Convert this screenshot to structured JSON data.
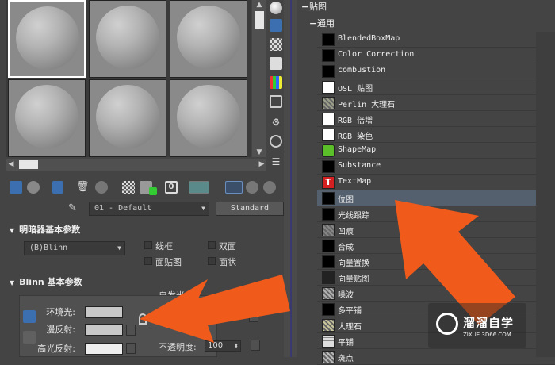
{
  "left": {
    "material_name": "01 - Default",
    "material_type_button": "Standard",
    "shader_rollout_title": "明暗器基本参数",
    "shader_value": "(B)Blinn",
    "shader_options": {
      "wire": "线框",
      "two_sided": "双面",
      "face_map": "面贴图",
      "faceted": "面状"
    },
    "blinn_rollout_title": "Blinn 基本参数",
    "self_illum_label": "自发光",
    "ambient_label": "环境光:",
    "diffuse_label": "漫反射:",
    "specular_label": "高光反射:",
    "opacity_label": "不透明度:",
    "opacity_value": "100"
  },
  "right": {
    "category_maps": "贴图",
    "category_general": "通用",
    "map_items": [
      {
        "label": "BlendedBoxMap",
        "icon": "black-swatch-icon",
        "color": "#000000"
      },
      {
        "label": "Color Correction",
        "icon": "black-swatch-icon",
        "color": "#000000"
      },
      {
        "label": "combustion",
        "icon": "black-swatch-icon",
        "color": "#000000"
      },
      {
        "label": "OSL 贴图",
        "icon": "white-swatch-icon",
        "color": "#ffffff"
      },
      {
        "label": "Perlin 大理石",
        "icon": "marble-swatch-icon",
        "color": "#9aa08a"
      },
      {
        "label": "RGB 倍增",
        "icon": "white-swatch-icon",
        "color": "#ffffff"
      },
      {
        "label": "RGB 染色",
        "icon": "white-swatch-icon",
        "color": "#ffffff"
      },
      {
        "label": "ShapeMap",
        "icon": "shapemap-icon",
        "color": "#5bbf2a"
      },
      {
        "label": "Substance",
        "icon": "black-swatch-icon",
        "color": "#000000"
      },
      {
        "label": "TextMap",
        "icon": "textmap-icon",
        "color": "#d42020"
      },
      {
        "label": "位图",
        "icon": "black-swatch-icon",
        "color": "#000000"
      },
      {
        "label": "光线跟踪",
        "icon": "black-swatch-icon",
        "color": "#000000"
      },
      {
        "label": "凹痕",
        "icon": "dent-swatch-icon",
        "color": "#888888"
      },
      {
        "label": "合成",
        "icon": "black-swatch-icon",
        "color": "#000000"
      },
      {
        "label": "向量置换",
        "icon": "black-swatch-icon",
        "color": "#000000"
      },
      {
        "label": "向量贴图",
        "icon": "vector-map-icon",
        "color": "#222222"
      },
      {
        "label": "噪波",
        "icon": "noise-swatch-icon",
        "color": "#b0b0b0"
      },
      {
        "label": "多平铺",
        "icon": "black-swatch-icon",
        "color": "#000000"
      },
      {
        "label": "大理石",
        "icon": "marble-swatch-icon",
        "color": "#c8c49a"
      },
      {
        "label": "平铺",
        "icon": "tile-swatch-icon",
        "color": "#dddddd"
      },
      {
        "label": "斑点",
        "icon": "speckle-swatch-icon",
        "color": "#bbbbbb"
      }
    ],
    "selected_index": 10
  },
  "watermark": {
    "brand": "溜溜自学",
    "url": "ZIXUE.3D66.COM"
  },
  "colors": {
    "annotation_arrow": "#f05a1a",
    "highlight": "#55606e",
    "panel_bg": "#444444"
  }
}
